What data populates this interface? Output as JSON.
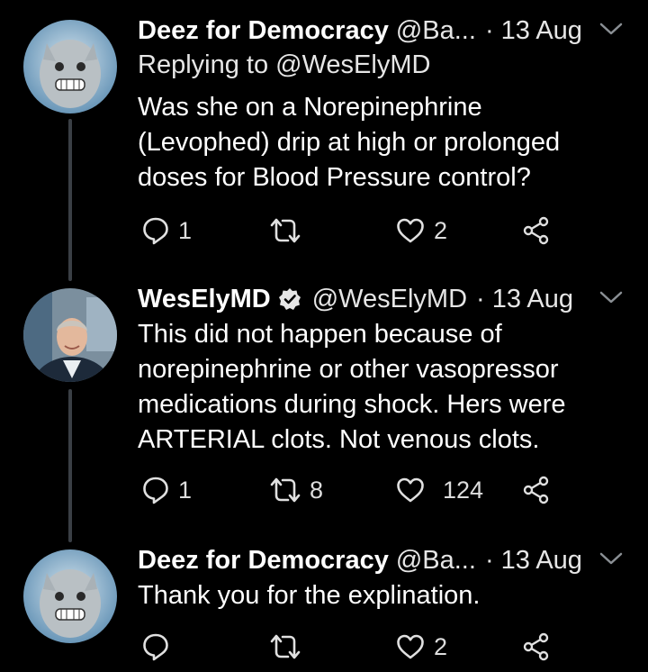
{
  "tweets": [
    {
      "name": "Deez for Democracy",
      "handle": "@Ba...",
      "time": "13 Aug",
      "reply_to": "Replying to @WesElyMD",
      "text": [
        "Was she on a Norepinephrine",
        "(Levophed) drip at high or prolonged",
        "doses for Blood Pressure control?"
      ],
      "replies": "1",
      "retweets": "",
      "likes": "2"
    },
    {
      "name": "WesElyMD",
      "handle": "@WesElyMD",
      "time": "13 Aug",
      "verified": true,
      "text": [
        "This did not happen because of",
        "norepinephrine or other vasopressor",
        "medications during shock. Hers were",
        "ARTERIAL clots. Not venous clots."
      ],
      "replies": "1",
      "retweets": "8",
      "likes": "124"
    },
    {
      "name": "Deez for Democracy",
      "handle": "@Ba...",
      "time": "13 Aug",
      "text": [
        "Thank you for the explination."
      ],
      "replies": "",
      "retweets": "",
      "likes": "2"
    }
  ],
  "separator": "·",
  "colors": {
    "background": "#000000",
    "text": "#ffffff",
    "secondary": "#e6e6e6",
    "thread_line": "#3a3f45"
  }
}
